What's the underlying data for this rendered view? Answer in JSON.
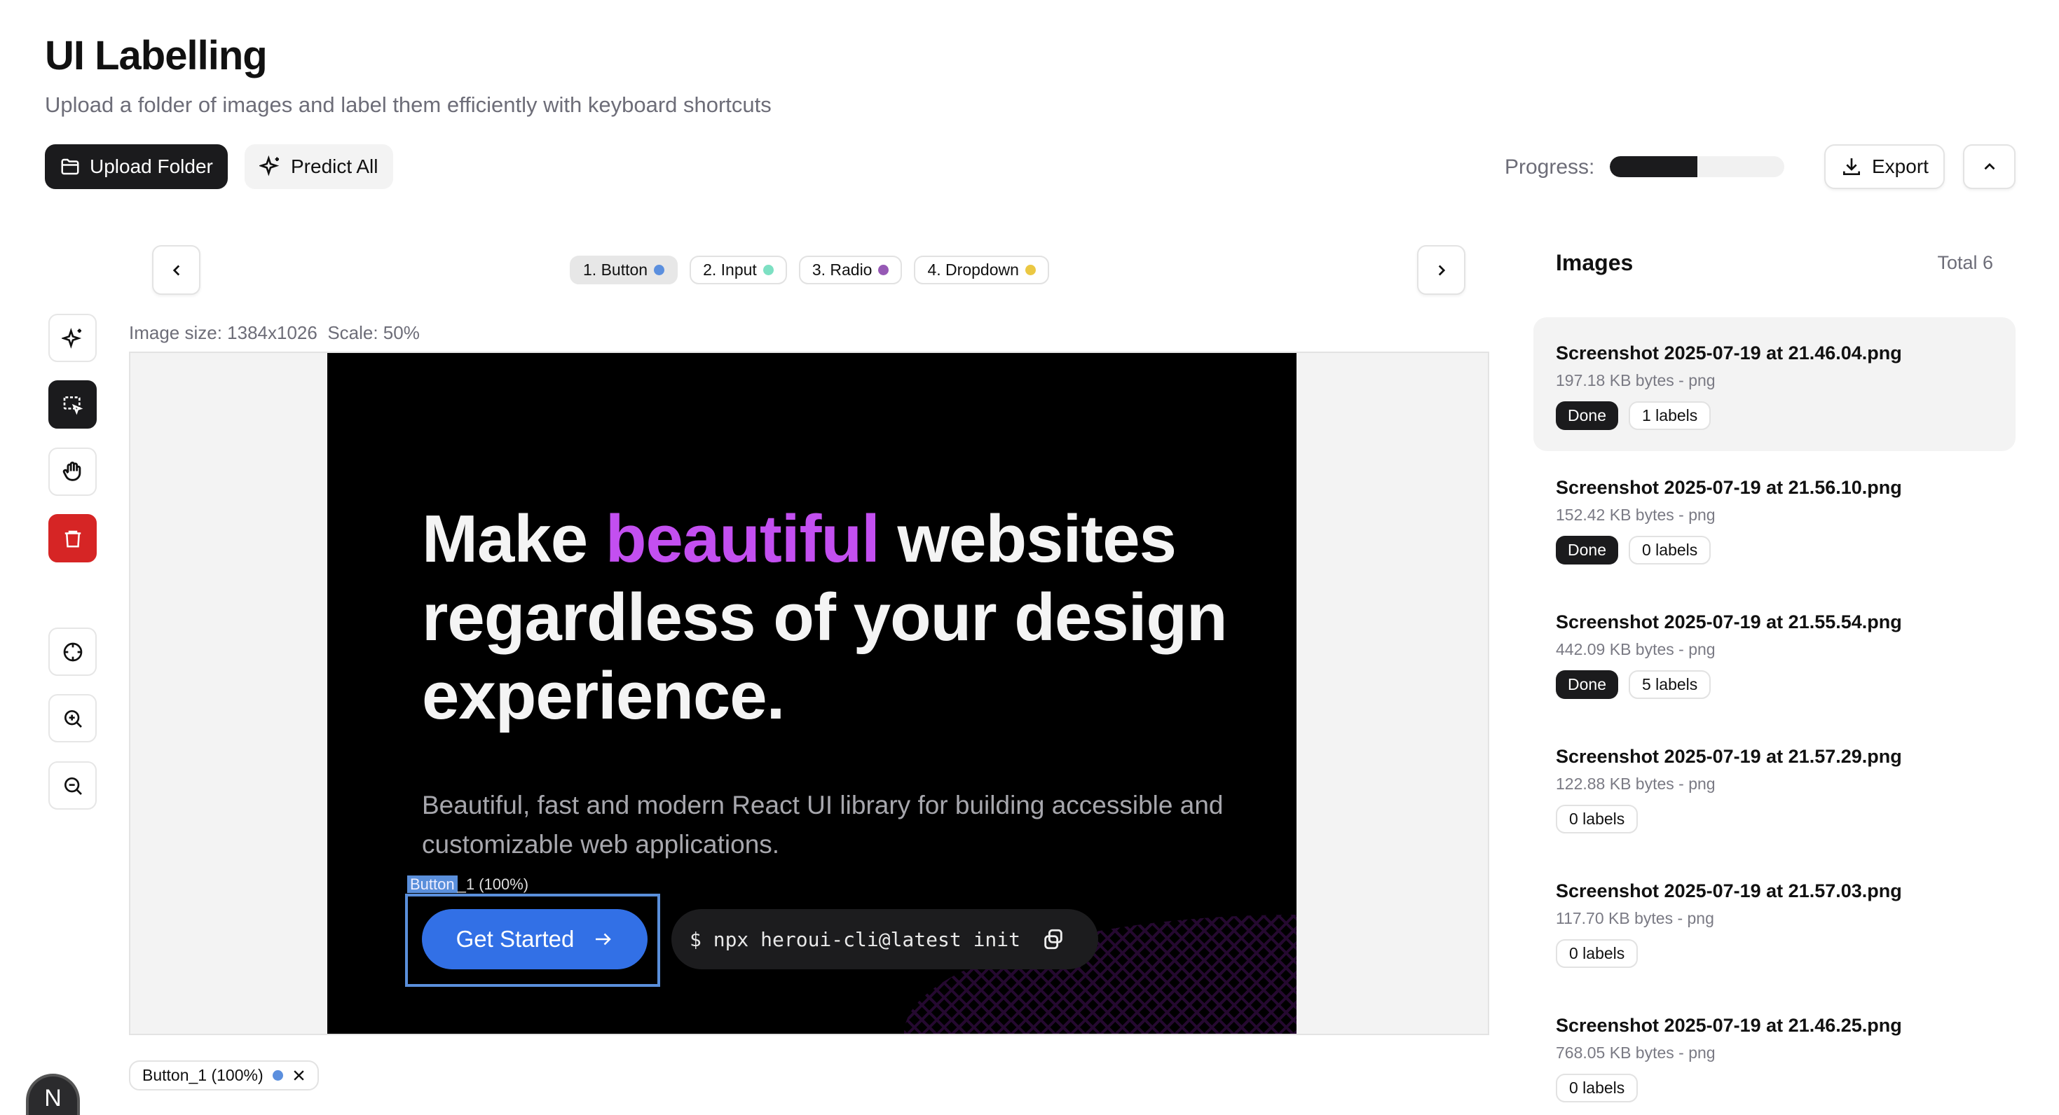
{
  "header": {
    "title": "UI Labelling",
    "subtitle": "Upload a folder of images and label them efficiently with keyboard shortcuts",
    "upload_label": "Upload Folder",
    "predict_label": "Predict All",
    "progress_label": "Progress:",
    "progress_percent": 50,
    "export_label": "Export"
  },
  "classes": [
    {
      "label": "1. Button",
      "color": "#5b8fde",
      "active": true
    },
    {
      "label": "2. Input",
      "color": "#7de0c3",
      "active": false
    },
    {
      "label": "3. Radio",
      "color": "#9659b5",
      "active": false
    },
    {
      "label": "4. Dropdown",
      "color": "#ebc843",
      "active": false
    }
  ],
  "canvas": {
    "image_size": "Image size: 1384x1026",
    "scale": "Scale: 50%",
    "headline_before": "Make ",
    "headline_accent": "beautiful",
    "headline_after": " websites",
    "headline_line2": "regardless of your design",
    "headline_line3": "experience.",
    "sub": "Beautiful, fast and modern React UI library for building accessible and customizable web applications.",
    "cta": "Get Started",
    "command": "$ npx heroui-cli@latest init",
    "bbox_label_class": "Button",
    "bbox_label_rest": "_1 (100%)",
    "bbox_color": "#5a8fdb"
  },
  "annotations": [
    {
      "label": "Button_1 (100%)",
      "color": "#5b8fde"
    }
  ],
  "avatar": "N",
  "images_panel": {
    "title": "Images",
    "total": "Total 6",
    "items": [
      {
        "name": "Screenshot 2025-07-19 at 21.46.04.png",
        "meta": "197.18 KB bytes - png",
        "status": "Done",
        "labels": "1 labels",
        "selected": true
      },
      {
        "name": "Screenshot 2025-07-19 at 21.56.10.png",
        "meta": "152.42 KB bytes - png",
        "status": "Done",
        "labels": "0 labels",
        "selected": false
      },
      {
        "name": "Screenshot 2025-07-19 at 21.55.54.png",
        "meta": "442.09 KB bytes - png",
        "status": "Done",
        "labels": "5 labels",
        "selected": false
      },
      {
        "name": "Screenshot 2025-07-19 at 21.57.29.png",
        "meta": "122.88 KB bytes - png",
        "status": null,
        "labels": "0 labels",
        "selected": false
      },
      {
        "name": "Screenshot 2025-07-19 at 21.57.03.png",
        "meta": "117.70 KB bytes - png",
        "status": null,
        "labels": "0 labels",
        "selected": false
      },
      {
        "name": "Screenshot 2025-07-19 at 21.46.25.png",
        "meta": "768.05 KB bytes - png",
        "status": null,
        "labels": "0 labels",
        "selected": false
      }
    ]
  }
}
